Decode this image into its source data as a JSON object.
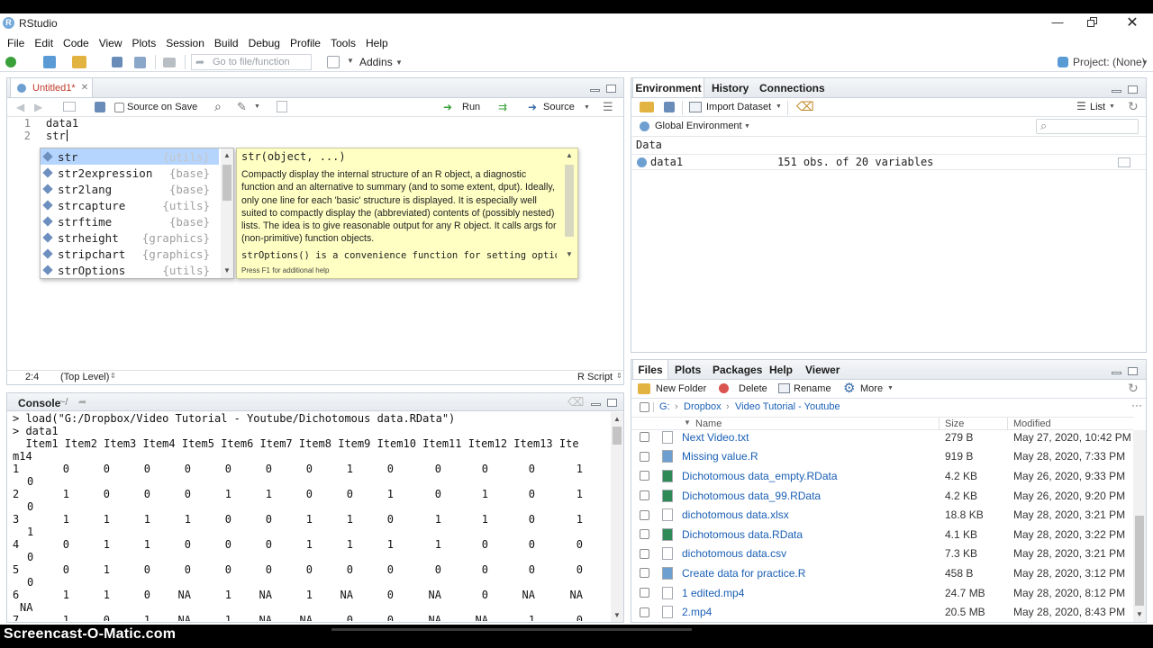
{
  "app": {
    "title": "RStudio"
  },
  "menus": [
    "File",
    "Edit",
    "Code",
    "View",
    "Plots",
    "Session",
    "Build",
    "Debug",
    "Profile",
    "Tools",
    "Help"
  ],
  "toolbar": {
    "goto_placeholder": "Go to file/function",
    "addins": "Addins",
    "project": "Project: (None)"
  },
  "editor": {
    "tab_title": "Untitled1*",
    "source_on_save": "Source on Save",
    "run": "Run",
    "source": "Source",
    "lines": [
      {
        "num": "1",
        "text": "data1"
      },
      {
        "num": "2",
        "text": "str"
      }
    ],
    "status_position": "2:4",
    "status_scope": "(Top Level)",
    "status_lang": "R Script"
  },
  "autocomplete": {
    "items": [
      {
        "name": "str",
        "pkg": "{utils}"
      },
      {
        "name": "str2expression",
        "pkg": "{base}"
      },
      {
        "name": "str2lang",
        "pkg": "{base}"
      },
      {
        "name": "strcapture",
        "pkg": "{utils}"
      },
      {
        "name": "strftime",
        "pkg": "{base}"
      },
      {
        "name": "strheight",
        "pkg": "{graphics}"
      },
      {
        "name": "stripchart",
        "pkg": "{graphics}"
      },
      {
        "name": "strOptions",
        "pkg": "{utils}"
      }
    ],
    "help_signature": "str(object, ...)",
    "help_p1": "Compactly display the internal structure of an R object, a diagnostic function and an alternative to summary (and to some extent, dput). Ideally, only one line for each 'basic' structure is displayed. It is especially well suited to compactly display the (abbreviated) contents of (possibly nested) lists. The idea is to give reasonable output for any R object. It calls args for (non-primitive) function objects.",
    "help_p2": "strOptions() is a convenience function for setting options(str =",
    "help_footer": "Press F1 for additional help"
  },
  "console": {
    "title": "Console",
    "path": "~/",
    "lines": [
      "> load(\"G:/Dropbox/Video Tutorial - Youtube/Dichotomous data.RData\")",
      "> data1",
      "  Item1 Item2 Item3 Item4 Item5 Item6 Item7 Item8 Item9 Item10 Item11 Item12 Item13 Ite",
      "m14"
    ],
    "rows": [
      {
        "id": "1",
        "vals": [
          "0",
          "0",
          "0",
          "0",
          "0",
          "0",
          "0",
          "1",
          "0",
          "0",
          "0",
          "0",
          "1"
        ],
        "wrap": "0"
      },
      {
        "id": "2",
        "vals": [
          "1",
          "0",
          "0",
          "0",
          "1",
          "1",
          "0",
          "0",
          "1",
          "0",
          "1",
          "0",
          "1"
        ],
        "wrap": "0"
      },
      {
        "id": "3",
        "vals": [
          "1",
          "1",
          "1",
          "1",
          "0",
          "0",
          "1",
          "1",
          "0",
          "1",
          "1",
          "0",
          "1"
        ],
        "wrap": "1"
      },
      {
        "id": "4",
        "vals": [
          "0",
          "1",
          "1",
          "0",
          "0",
          "0",
          "1",
          "1",
          "1",
          "1",
          "0",
          "0",
          "0"
        ],
        "wrap": "0"
      },
      {
        "id": "5",
        "vals": [
          "0",
          "1",
          "0",
          "0",
          "0",
          "0",
          "0",
          "0",
          "0",
          "0",
          "0",
          "0",
          "0"
        ],
        "wrap": "0"
      },
      {
        "id": "6",
        "vals": [
          "1",
          "1",
          "0",
          "NA",
          "1",
          "NA",
          "1",
          "NA",
          "0",
          "NA",
          "0",
          "NA",
          "NA"
        ],
        "wrap": "NA"
      },
      {
        "id": "7",
        "vals": [
          "1",
          "0",
          "1",
          "NA",
          "1",
          "NA",
          "NA",
          "0",
          "0",
          "NA",
          "NA",
          "1",
          "0"
        ],
        "wrap": ""
      }
    ]
  },
  "environment": {
    "tabs": [
      "Environment",
      "History",
      "Connections"
    ],
    "import_dataset": "Import Dataset",
    "view_mode": "List",
    "scope": "Global Environment",
    "section": "Data",
    "objects": [
      {
        "name": "data1",
        "desc": "151 obs. of 20 variables"
      }
    ]
  },
  "files": {
    "tabs": [
      "Files",
      "Plots",
      "Packages",
      "Help",
      "Viewer"
    ],
    "new_folder": "New Folder",
    "delete": "Delete",
    "rename": "Rename",
    "more": "More",
    "breadcrumb": [
      "G:",
      "Dropbox",
      "Video Tutorial - Youtube"
    ],
    "headers": {
      "name": "Name",
      "size": "Size",
      "modified": "Modified"
    },
    "rows": [
      {
        "name": "Next Video.txt",
        "size": "279 B",
        "modified": "May 27, 2020, 10:42 PM"
      },
      {
        "name": "Missing value.R",
        "size": "919 B",
        "modified": "May 28, 2020, 7:33 PM"
      },
      {
        "name": "Dichotomous data_empty.RData",
        "size": "4.2 KB",
        "modified": "May 26, 2020, 9:33 PM"
      },
      {
        "name": "Dichotomous data_99.RData",
        "size": "4.2 KB",
        "modified": "May 26, 2020, 9:20 PM"
      },
      {
        "name": "dichotomous data.xlsx",
        "size": "18.8 KB",
        "modified": "May 28, 2020, 3:21 PM"
      },
      {
        "name": "Dichotomous data.RData",
        "size": "4.1 KB",
        "modified": "May 28, 2020, 3:22 PM"
      },
      {
        "name": "dichotomous data.csv",
        "size": "7.3 KB",
        "modified": "May 28, 2020, 3:21 PM"
      },
      {
        "name": "Create data for practice.R",
        "size": "458 B",
        "modified": "May 28, 2020, 3:12 PM"
      },
      {
        "name": "1 edited.mp4",
        "size": "24.7 MB",
        "modified": "May 28, 2020, 8:12 PM"
      },
      {
        "name": "2.mp4",
        "size": "20.5 MB",
        "modified": "May 28, 2020, 8:43 PM"
      }
    ]
  },
  "watermark": "Screencast-O-Matic.com",
  "colors": {
    "accent": "#1a5fb4",
    "selection": "#b5d5ff",
    "help_bg": "#ffffc4"
  }
}
